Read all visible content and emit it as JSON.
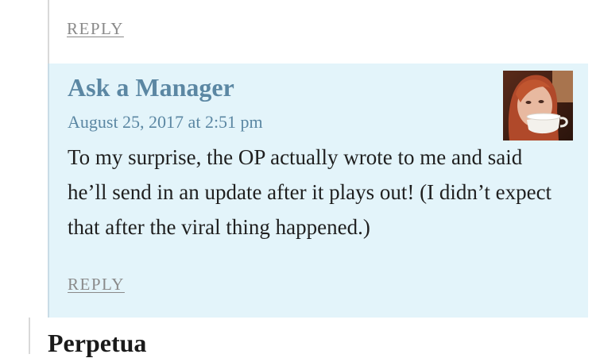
{
  "comments": {
    "previous": {
      "reply_label": "REPLY"
    },
    "current": {
      "author": "Ask a Manager",
      "date": "August 25, 2017 at 2:51 pm",
      "body": "To my surprise, the OP actually wrote to me and said he’ll send in an update after it plays out! (I didn’t expect that after the viral thing happened.)",
      "reply_label": "REPLY",
      "avatar_icon": "author-avatar-photo"
    },
    "next": {
      "author": "Perpetua"
    }
  },
  "colors": {
    "comment_background": "#e3f4fa",
    "author_link": "#5b87a3",
    "reply_link": "#8a8a8a"
  }
}
